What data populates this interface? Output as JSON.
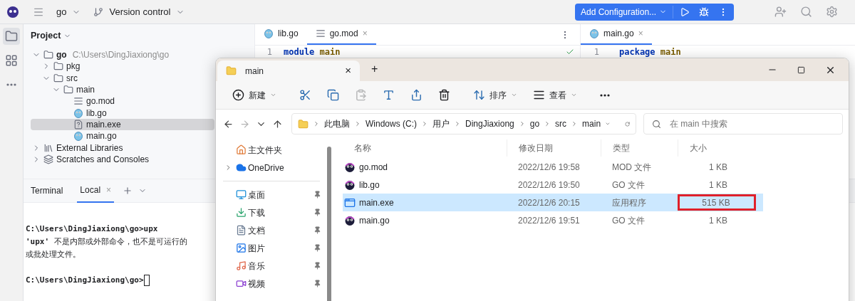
{
  "top_bar": {
    "project": "go",
    "vcs": "Version control",
    "run_config": "Add Configuration..."
  },
  "tool_strip": [
    {
      "kind": "project",
      "selected": true
    },
    {
      "kind": "structure",
      "selected": false
    },
    {
      "kind": "more",
      "selected": false
    }
  ],
  "project_panel": {
    "title": "Project",
    "tree": [
      {
        "label": "go",
        "path": "C:\\Users\\DingJiaxiong\\go",
        "kind": "folder",
        "expanded": true,
        "selected": false,
        "children": [
          {
            "label": "pkg",
            "kind": "folder",
            "expanded": false,
            "selected": false
          },
          {
            "label": "src",
            "kind": "folder",
            "expanded": true,
            "selected": false,
            "children": [
              {
                "label": "main",
                "kind": "folder",
                "expanded": true,
                "selected": false,
                "children": [
                  {
                    "label": "go.mod",
                    "kind": "text",
                    "selected": false
                  },
                  {
                    "label": "lib.go",
                    "kind": "gopher",
                    "selected": false
                  },
                  {
                    "label": "main.exe",
                    "kind": "unknown",
                    "selected": true
                  },
                  {
                    "label": "main.go",
                    "kind": "gopher",
                    "selected": false
                  }
                ]
              }
            ]
          }
        ]
      },
      {
        "label": "External Libraries",
        "kind": "library",
        "expanded": false,
        "selected": false
      },
      {
        "label": "Scratches and Consoles",
        "kind": "scratches",
        "expanded": false,
        "selected": false
      }
    ]
  },
  "editors": [
    {
      "tabs": [
        {
          "label": "lib.go",
          "kind": "gopher",
          "selected": false
        },
        {
          "label": "go.mod",
          "kind": "text",
          "selected": true
        }
      ],
      "close": "×",
      "check": true,
      "lines": [
        {
          "number": "1",
          "tokens": [
            {
              "text": "module",
              "kind": "keyword"
            },
            {
              "text": "main",
              "kind": "name"
            }
          ]
        }
      ]
    },
    {
      "tabs": [
        {
          "label": "main.go",
          "kind": "gopher",
          "selected": true
        }
      ],
      "close": "×",
      "lines": [
        {
          "number": "1",
          "tokens": [
            {
              "text": "package",
              "kind": "keyword"
            },
            {
              "text": "main",
              "kind": "name"
            }
          ]
        }
      ]
    }
  ],
  "terminal": {
    "title": "Terminal",
    "tabs": [
      {
        "label": "Local",
        "selected": true
      }
    ],
    "close": "×",
    "lines": [
      {
        "kind": "prompt",
        "text": "C:\\Users\\DingJiaxiong\\go>upx"
      },
      {
        "kind": "output",
        "text": "**'upx'** 不是内部或外部命令，也不是可运行的"
      },
      {
        "kind": "output",
        "text": "或批处理文件。"
      },
      {
        "kind": "prompt",
        "text": "C:\\Users\\DingJiaxiong\\go>",
        "cursor": true
      }
    ]
  },
  "explorer": {
    "tab": {
      "label": "main",
      "close": "×"
    },
    "new_tab": "+",
    "toolbar": [
      {
        "kind": "new",
        "label": "新建",
        "disabled": false
      },
      {
        "kind": "cut",
        "disabled": false
      },
      {
        "kind": "copy",
        "disabled": false
      },
      {
        "kind": "paste",
        "disabled": true
      },
      {
        "kind": "rename",
        "disabled": false
      },
      {
        "kind": "share",
        "disabled": false
      },
      {
        "kind": "delete",
        "disabled": false
      },
      {
        "kind": "sort",
        "label": "排序",
        "disabled": false
      },
      {
        "kind": "view",
        "label": "查看",
        "disabled": false
      },
      {
        "kind": "more",
        "disabled": false
      }
    ],
    "nav_buttons": [
      {
        "kind": "back",
        "disabled": false
      },
      {
        "kind": "forward",
        "disabled": true
      },
      {
        "kind": "recent",
        "disabled": false
      },
      {
        "kind": "up",
        "disabled": false
      }
    ],
    "breadcrumb": [
      "此电脑",
      "Windows (C:)",
      "用户",
      "DingJiaxiong",
      "go",
      "src",
      "main"
    ],
    "search": {
      "placeholder": "在 main 中搜索"
    },
    "nav": [
      {
        "label": "主文件夹",
        "kind": "home",
        "pinned": false
      },
      {
        "label": "OneDrive",
        "kind": "cloud",
        "pinned": false
      },
      {
        "label": "桌面",
        "kind": "desktop",
        "pinned": true
      },
      {
        "label": "下载",
        "kind": "download",
        "pinned": true
      },
      {
        "label": "文档",
        "kind": "documents",
        "pinned": true
      },
      {
        "label": "图片",
        "kind": "pictures",
        "pinned": true
      },
      {
        "label": "音乐",
        "kind": "music",
        "pinned": true
      },
      {
        "label": "视频",
        "kind": "videos",
        "pinned": true
      }
    ],
    "columns": [
      "名称",
      "修改日期",
      "类型",
      "大小"
    ],
    "files": [
      {
        "name": "go.mod",
        "kind": "gopher",
        "date": "2022/12/6 19:58",
        "type": "MOD 文件",
        "size": "1 KB",
        "selected": false,
        "highlighted": false
      },
      {
        "name": "lib.go",
        "kind": "gopher",
        "date": "2022/12/6 19:50",
        "type": "GO 文件",
        "size": "1 KB",
        "selected": false,
        "highlighted": false
      },
      {
        "name": "main.exe",
        "kind": "exe",
        "date": "2022/12/6 20:15",
        "type": "应用程序",
        "size": "515 KB",
        "selected": true,
        "highlighted": true
      },
      {
        "name": "main.go",
        "kind": "gopher",
        "date": "2022/12/6 19:51",
        "type": "GO 文件",
        "size": "1 KB",
        "selected": false,
        "highlighted": false
      }
    ]
  }
}
